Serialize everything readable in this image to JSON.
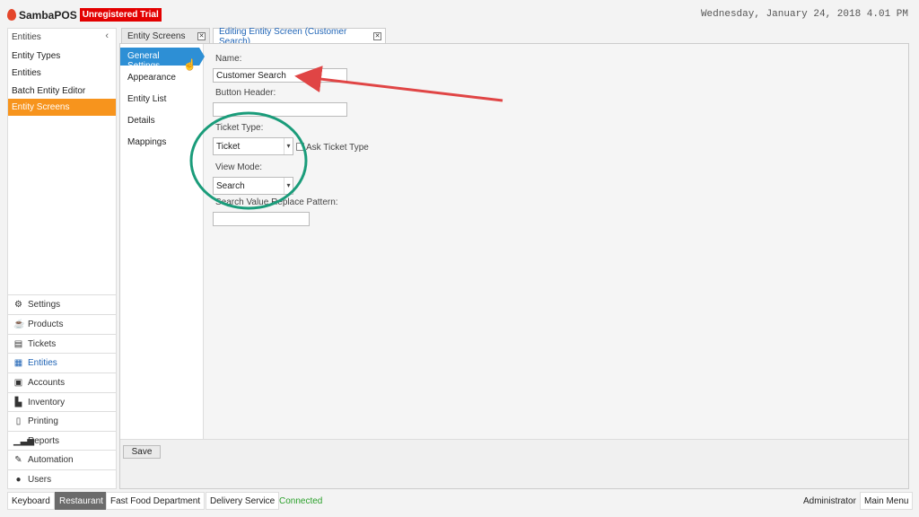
{
  "header": {
    "app_name": "SambaPOS",
    "trial_badge": "Unregistered Trial",
    "datetime": "Wednesday, January 24, 2018 4.01 PM"
  },
  "sidebar": {
    "title": "Entities",
    "collapse_icon": "‹",
    "items": [
      {
        "label": "Entity Types"
      },
      {
        "label": "Entities"
      },
      {
        "label": "Batch Entity Editor"
      },
      {
        "label": "Entity Screens",
        "active": true
      }
    ],
    "modules": [
      {
        "label": "Settings",
        "icon": "gear-icon"
      },
      {
        "label": "Products",
        "icon": "cup-icon"
      },
      {
        "label": "Tickets",
        "icon": "tickets-icon"
      },
      {
        "label": "Entities",
        "icon": "entities-icon",
        "active": true
      },
      {
        "label": "Accounts",
        "icon": "calculator-icon"
      },
      {
        "label": "Inventory",
        "icon": "inventory-icon"
      },
      {
        "label": "Printing",
        "icon": "document-icon"
      },
      {
        "label": "Reports",
        "icon": "bar-chart-icon"
      },
      {
        "label": "Automation",
        "icon": "pen-icon"
      },
      {
        "label": "Users",
        "icon": "user-icon"
      }
    ]
  },
  "tabs": [
    {
      "label": "Entity Screens"
    },
    {
      "label": "Editing Entity Screen (Customer Search)",
      "active": true
    }
  ],
  "settings_nav": {
    "items": [
      {
        "label": "General Settings",
        "active": true
      },
      {
        "label": "Appearance"
      },
      {
        "label": "Entity List"
      },
      {
        "label": "Details"
      },
      {
        "label": "Mappings"
      }
    ]
  },
  "form": {
    "name_label": "Name:",
    "name_value": "Customer Search",
    "button_header_label": "Button Header:",
    "button_header_value": "",
    "ticket_type_label": "Ticket Type:",
    "ticket_type_value": "Ticket",
    "ask_ticket_type_label": "Ask Ticket Type",
    "ask_ticket_type_checked": false,
    "view_mode_label": "View Mode:",
    "view_mode_value": "Search",
    "search_pattern_label": "Search Value Replace Pattern:",
    "search_pattern_value": "",
    "save_label": "Save"
  },
  "statusbar": {
    "keyboard": "Keyboard",
    "restaurant": "Restaurant",
    "department": "Fast Food Department",
    "delivery": "Delivery Service",
    "connection": "Connected",
    "user": "Administrator",
    "main_menu": "Main Menu"
  },
  "colors": {
    "accent_orange": "#f7941d",
    "accent_blue": "#2d8fd5",
    "trial_red": "#e30000",
    "connected_green": "#2aa02a",
    "annotation_arrow": "#e04545",
    "annotation_circle": "#1a9c7a"
  }
}
